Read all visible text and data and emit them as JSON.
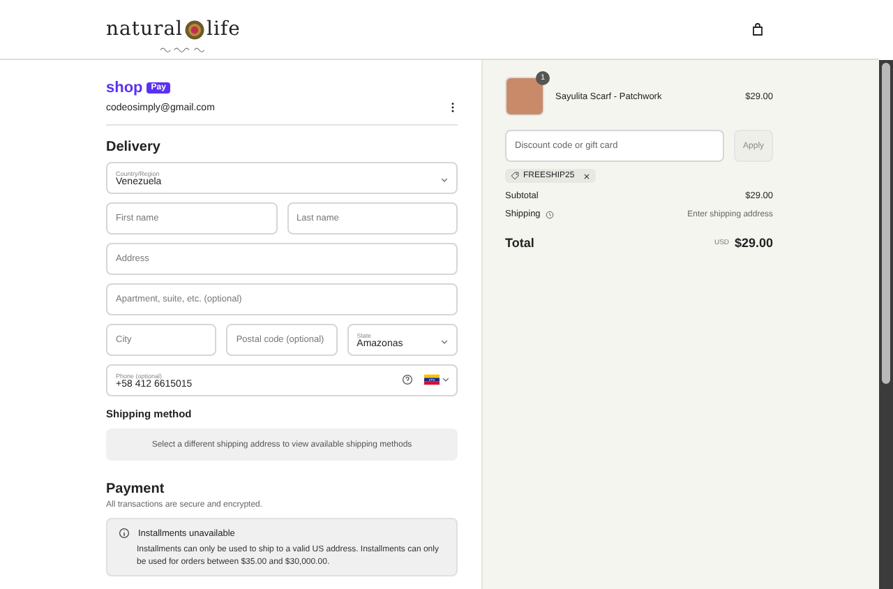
{
  "header": {
    "brand_left": "natural",
    "brand_right": "life"
  },
  "contact": {
    "wallet": "shop",
    "wallet_badge": "Pay",
    "email": "codeosimply@gmail.com"
  },
  "delivery": {
    "title": "Delivery",
    "rows": [
      [
        {
          "kind": "select",
          "label": "Country/Region",
          "value": "Venezuela"
        }
      ],
      [
        {
          "kind": "text",
          "placeholder": "First name"
        },
        {
          "kind": "text",
          "placeholder": "Last name"
        }
      ],
      [
        {
          "kind": "text",
          "placeholder": "Address"
        }
      ],
      [
        {
          "kind": "text",
          "placeholder": "Apartment, suite, etc. (optional)"
        }
      ],
      [
        {
          "kind": "text",
          "placeholder": "City"
        },
        {
          "kind": "text",
          "placeholder": "Postal code (optional)"
        },
        {
          "kind": "select",
          "label": "State",
          "value": "Amazonas"
        }
      ],
      [
        {
          "kind": "phone",
          "label": "Phone (optional)",
          "value": "+58 412 6615015"
        }
      ]
    ]
  },
  "shipping": {
    "title": "Shipping method",
    "message": "Select a different shipping address to view available shipping methods"
  },
  "payment": {
    "title": "Payment",
    "subtitle": "All transactions are secure and encrypted.",
    "notice": {
      "title": "Installments unavailable",
      "body": "Installments can only be used to ship to a valid US address. Installments can only be used for orders between $35.00 and $30,000.00."
    }
  },
  "summary": {
    "items": [
      {
        "name": "Sayulita Scarf - Patchwork",
        "price": "$29.00",
        "quantity": "1"
      }
    ],
    "discount": {
      "placeholder": "Discount code or gift card",
      "button": "Apply"
    },
    "codes": [
      {
        "code": "FREESHIP25"
      }
    ],
    "lines": [
      {
        "label": "Subtotal",
        "value": "$29.00",
        "info": false
      },
      {
        "label": "Shipping",
        "value": "Enter shipping address",
        "info": true
      }
    ],
    "total": {
      "label": "Total",
      "currency": "USD",
      "value": "$29.00"
    }
  }
}
